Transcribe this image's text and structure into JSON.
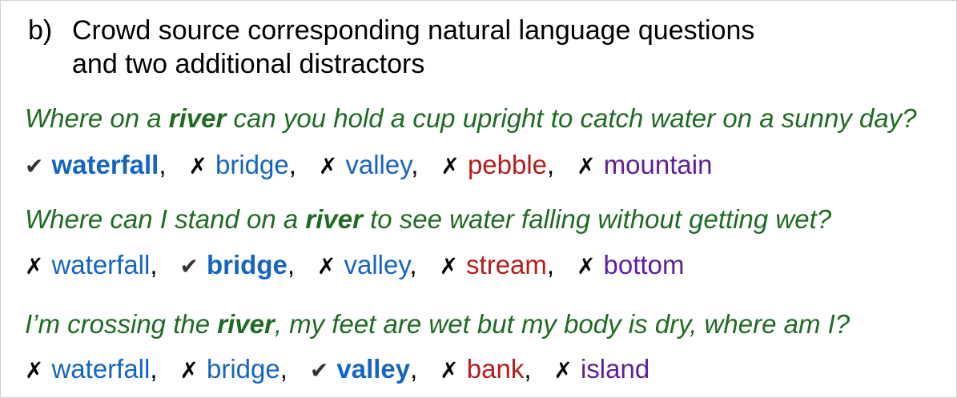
{
  "heading": {
    "label": "b)",
    "text": "Crowd source corresponding natural language questions\nand two additional distractors"
  },
  "questions": [
    {
      "pre": "Where on a ",
      "keyword": "river",
      "post": " can you hold a cup upright to catch water on a sunny day?",
      "answers": [
        {
          "mark": "✔",
          "correct": true,
          "word": "waterfall",
          "color": "#1565c0",
          "sep": ","
        },
        {
          "mark": "✗",
          "correct": false,
          "word": "bridge",
          "color": "#1565c0",
          "sep": ","
        },
        {
          "mark": "✗",
          "correct": false,
          "word": "valley",
          "color": "#1565c0",
          "sep": ","
        },
        {
          "mark": "✗",
          "correct": false,
          "word": "pebble",
          "color": "#b71c1c",
          "sep": ","
        },
        {
          "mark": "✗",
          "correct": false,
          "word": "mountain",
          "color": "#5e1f9a",
          "sep": ""
        }
      ]
    },
    {
      "pre": "Where can I stand on a ",
      "keyword": "river",
      "post": " to see water falling without getting wet?",
      "answers": [
        {
          "mark": "✗",
          "correct": false,
          "word": "waterfall",
          "color": "#1565c0",
          "sep": ","
        },
        {
          "mark": "✔",
          "correct": true,
          "word": "bridge",
          "color": "#1565c0",
          "sep": ","
        },
        {
          "mark": "✗",
          "correct": false,
          "word": "valley",
          "color": "#1565c0",
          "sep": ","
        },
        {
          "mark": "✗",
          "correct": false,
          "word": "stream",
          "color": "#b71c1c",
          "sep": ","
        },
        {
          "mark": "✗",
          "correct": false,
          "word": "bottom",
          "color": "#5e1f9a",
          "sep": ""
        }
      ]
    },
    {
      "pre": "I’m crossing the ",
      "keyword": "river",
      "post": ", my feet are wet but my body is dry, where am I?",
      "answers": [
        {
          "mark": "✗",
          "correct": false,
          "word": "waterfall",
          "color": "#1565c0",
          "sep": ","
        },
        {
          "mark": "✗",
          "correct": false,
          "word": "bridge",
          "color": "#1565c0",
          "sep": ","
        },
        {
          "mark": "✔",
          "correct": true,
          "word": "valley",
          "color": "#1565c0",
          "sep": ","
        },
        {
          "mark": "✗",
          "correct": false,
          "word": "bank",
          "color": "#b71c1c",
          "sep": ","
        },
        {
          "mark": "✗",
          "correct": false,
          "word": "island",
          "color": "#5e1f9a",
          "sep": ""
        }
      ]
    }
  ]
}
